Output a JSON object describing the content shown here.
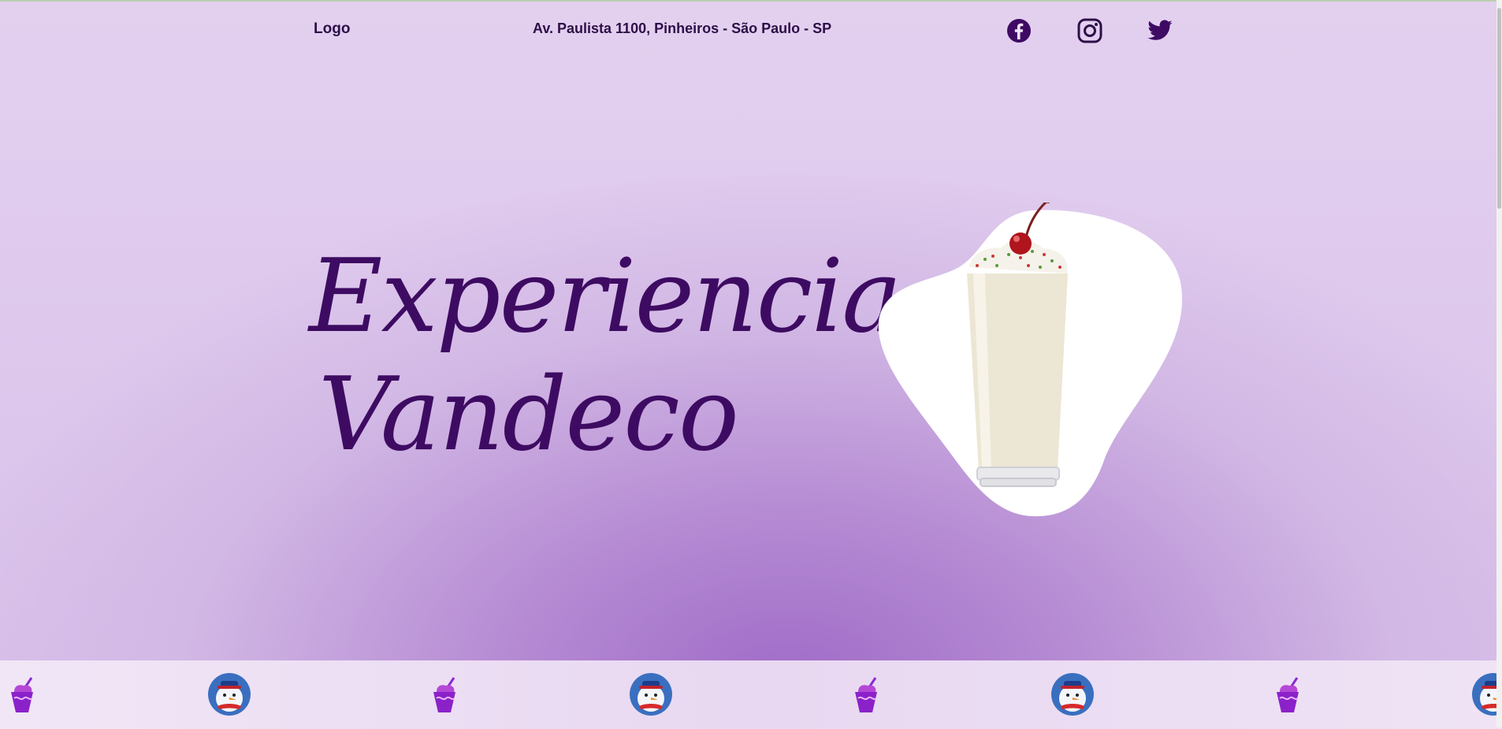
{
  "header": {
    "logo_label": "Logo",
    "address": "Av. Paulista 1100, Pinheiros - São Paulo - SP",
    "social": [
      {
        "name": "facebook-icon"
      },
      {
        "name": "instagram-icon"
      },
      {
        "name": "twitter-icon"
      }
    ]
  },
  "hero": {
    "title_line1": "Experiencia",
    "title_line2": "Vandeco"
  },
  "band": {
    "items": [
      "milkshake-cup-icon",
      "snowman-icon",
      "milkshake-cup-icon",
      "snowman-icon",
      "milkshake-cup-icon",
      "snowman-icon",
      "milkshake-cup-icon",
      "snowman-icon"
    ]
  },
  "colors": {
    "text_dark": "#2e0f48",
    "title": "#3e0b62",
    "background_center": "#a06cc8",
    "background_edge": "#efe4f5",
    "icon_purple": "#3f0a63"
  }
}
